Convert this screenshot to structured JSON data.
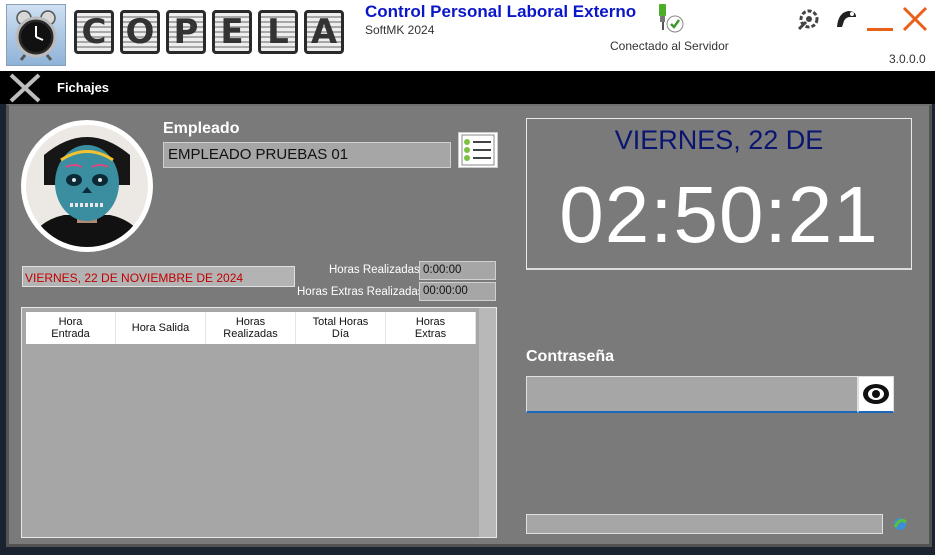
{
  "header": {
    "logo_letters": [
      "C",
      "O",
      "P",
      "E",
      "L",
      "A"
    ],
    "title": "Control Personal Laboral Externo",
    "subtitle": "SoftMK 2024",
    "server_status": "Conectado al Servidor",
    "version": "3.0.0.0",
    "icons": [
      "alarm-clock-icon",
      "server-connected-icon",
      "settings-icon",
      "user-icon",
      "minimize-icon",
      "close-icon"
    ]
  },
  "form": {
    "title": "Fichajes"
  },
  "employee": {
    "label": "Empleado",
    "name": "EMPLEADO PRUEBAS 01"
  },
  "date_text": "VIERNES, 22 DE NOVIEMBRE DE 2024",
  "hours": {
    "realizadas_label": "Horas Realizadas:",
    "realizadas_value": "0:00:00",
    "extras_label": "Horas Extras Realizadas:",
    "extras_value": "00:00:00"
  },
  "grid": {
    "columns": [
      "Hora\nEntrada",
      "Hora Salida",
      "Horas\nRealizadas",
      "Total Horas\nDía",
      "Horas\nExtras"
    ]
  },
  "clock": {
    "day": "VIERNES, 22 DE",
    "time": "02:50:21"
  },
  "password": {
    "label": "Contraseña",
    "value": ""
  },
  "colors": {
    "title_blue": "#0b16c9",
    "date_red": "#c00000",
    "panel_gray": "#7a7a7a",
    "field_gray": "#a6a6a6",
    "clock_day_blue": "#0a1570",
    "accent_orange": "#e8601a"
  }
}
